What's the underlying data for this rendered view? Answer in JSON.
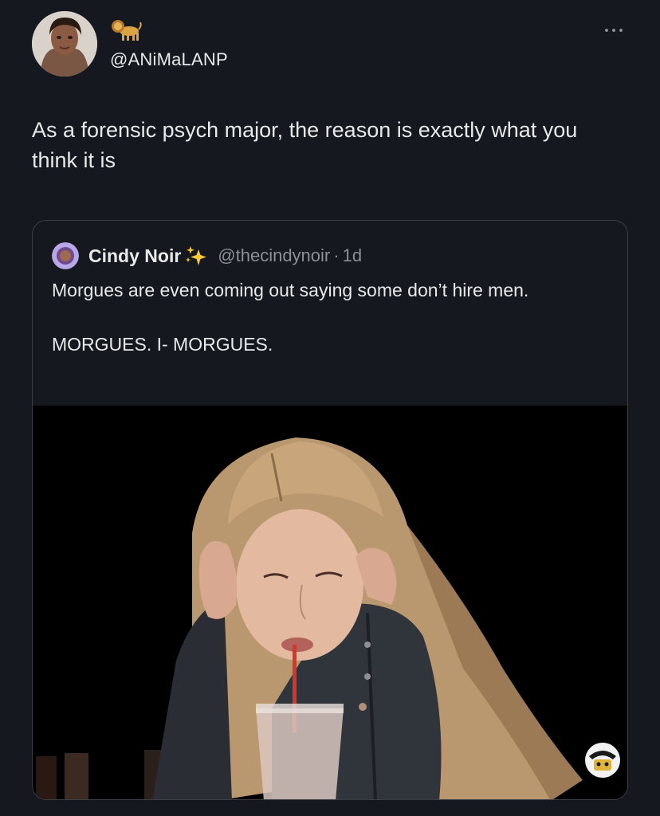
{
  "tweet": {
    "author_handle": "@ANiMaLANP",
    "badge_icon": "lion-emoji-icon",
    "text": "As a forensic psych major, the reason is exactly what you think it is"
  },
  "quoted_tweet": {
    "display_name": "Cindy Noir",
    "name_icon": "sparkles-emoji-icon",
    "handle": "@thecindynoir",
    "separator": "·",
    "time": "1d",
    "text_line1": "Morgues are even coming out saying some don’t hire men.",
    "text_line2": "MORGUES. I- MORGUES."
  },
  "colors": {
    "background": "#15181e",
    "text_primary": "#e7e9ea",
    "text_secondary": "#8b8f96",
    "card_border": "#3a3f47"
  }
}
